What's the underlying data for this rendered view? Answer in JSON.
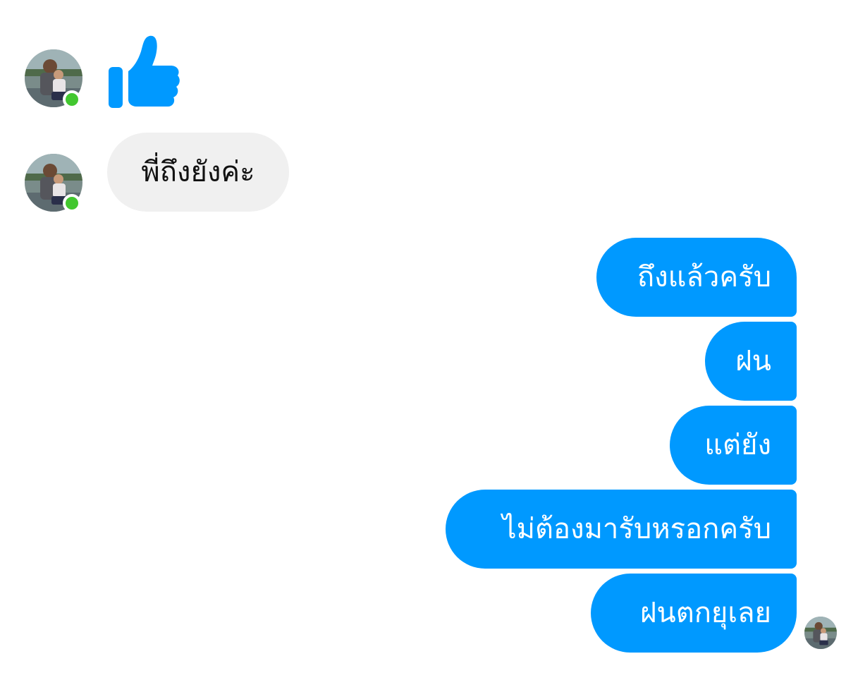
{
  "conversation": {
    "incoming": [
      {
        "type": "like",
        "icon": "thumbs-up-icon"
      },
      {
        "type": "text",
        "text": "พี่ถึงยังค่ะ"
      }
    ],
    "outgoing": [
      {
        "text": "ถึงแล้วครับ"
      },
      {
        "text": "ฝน"
      },
      {
        "text": "แต่ยัง"
      },
      {
        "text": "ไม่ต้องมารับหรอกครับ"
      },
      {
        "text": "ฝนตกยุเลย"
      }
    ]
  },
  "colors": {
    "outgoing_bubble": "#0099ff",
    "incoming_bubble": "#f0f0f0",
    "like_icon": "#0099ff",
    "presence_online": "#42c72f"
  },
  "contact": {
    "online": true
  }
}
